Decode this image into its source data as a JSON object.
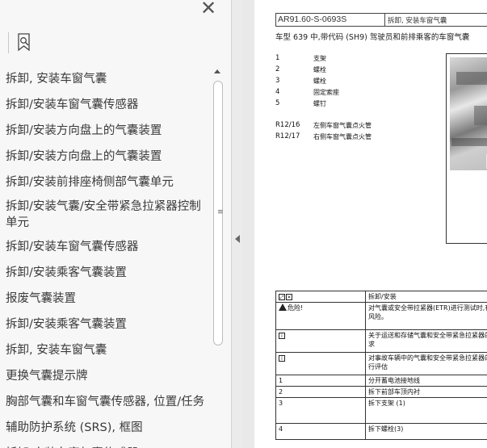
{
  "sidebar": {
    "items": [
      {
        "label": "拆卸, 安装车窗气囊"
      },
      {
        "label": "拆卸/安装车窗气囊传感器"
      },
      {
        "label": "拆卸/安装方向盘上的气囊装置"
      },
      {
        "label": "拆卸/安装方向盘上的气囊装置"
      },
      {
        "label": "拆卸/安装前排座椅侧部气囊单元"
      },
      {
        "label": "拆卸/安装气囊/安全带紧急拉紧器控制单元"
      },
      {
        "label": "拆卸/安装车窗气囊传感器"
      },
      {
        "label": "拆卸/安装乘客气囊装置"
      },
      {
        "label": "报废气囊装置"
      },
      {
        "label": "拆卸/安装乘客气囊装置"
      },
      {
        "label": "拆卸, 安装车窗气囊"
      },
      {
        "label": "更换气囊提示牌"
      },
      {
        "label": "胸部气囊和车窗气囊传感器, 位置/任务"
      },
      {
        "label": "辅助防护系统 (SRS), 框图"
      },
      {
        "label": "拆卸/安装车窗气囊传感器"
      }
    ]
  },
  "document": {
    "header_code": "AR91.60-S-0693S",
    "header_title": "拆卸, 安装车窗气囊",
    "intro": "车型  639 中,带代码 (SH9) 驾驶员和前排乘客的车窗气囊",
    "parts": [
      {
        "num": "1",
        "name": "支架"
      },
      {
        "num": "2",
        "name": "螺栓"
      },
      {
        "num": "3",
        "name": "螺栓"
      },
      {
        "num": "4",
        "name": "固定索座"
      },
      {
        "num": "5",
        "name": "螺钉"
      }
    ],
    "refs": [
      {
        "code": "R12/16",
        "name": "左侧车窗气囊点火管"
      },
      {
        "code": "R12/17",
        "name": "右侧车窗气囊点火管"
      }
    ],
    "table": {
      "head": "拆卸/安装",
      "danger_label": "危险!",
      "danger_text": "对气囊或安全带拉紧器(ETR)进行测试时,有受伤的风险。",
      "info1": "关于运送和存储气囊和安全带紧急拉紧器的法规要求",
      "info2": "对事故车辆中的气囊和安全带紧急拉紧器的状况进行评估",
      "steps": [
        {
          "num": "1",
          "text": "分开蓄电池接地线"
        },
        {
          "num": "2",
          "text": "拆下前部车顶内衬"
        },
        {
          "num": "3",
          "text": "拆下支架 (1)"
        },
        {
          "num": "4",
          "text": "拆下螺栓(3)"
        }
      ]
    }
  }
}
